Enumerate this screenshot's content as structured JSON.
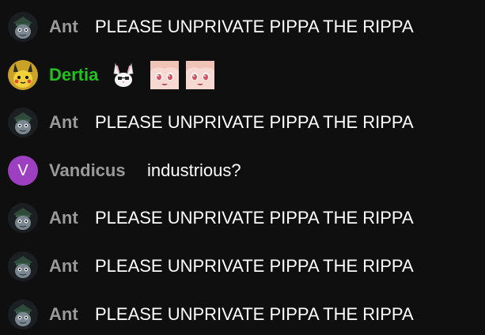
{
  "chat": {
    "messages": [
      {
        "author": "Ant",
        "text": "PLEASE UNPRIVATE PIPPA THE RIPPA",
        "avatar": "cat-in-hat-icon"
      },
      {
        "author": "Dertia",
        "text": "",
        "avatar": "pikachu-avatar-icon",
        "author_color": "#22c21b",
        "emotes": [
          "bunny-emote-icon",
          "anime-girl-face-emote-icon",
          "anime-girl-face-emote-icon"
        ]
      },
      {
        "author": "Ant",
        "text": "PLEASE UNPRIVATE PIPPA THE RIPPA",
        "avatar": "cat-in-hat-icon"
      },
      {
        "author": "Vandicus",
        "text": "industrious?",
        "avatar": "letter-avatar",
        "avatar_letter": "V",
        "avatar_color": "#9c3fc0"
      },
      {
        "author": "Ant",
        "text": "PLEASE UNPRIVATE PIPPA THE RIPPA",
        "avatar": "cat-in-hat-icon"
      },
      {
        "author": "Ant",
        "text": "PLEASE UNPRIVATE PIPPA THE RIPPA",
        "avatar": "cat-in-hat-icon"
      },
      {
        "author": "Ant",
        "text": "PLEASE UNPRIVATE PIPPA THE RIPPA",
        "avatar": "cat-in-hat-icon"
      }
    ]
  },
  "colors": {
    "background": "#0f0f0f",
    "author_default": "#9a9a9a",
    "message_text": "#ffffff"
  }
}
